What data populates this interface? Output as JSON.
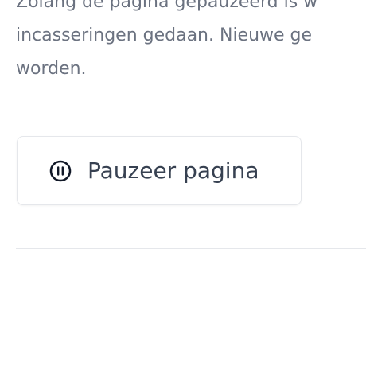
{
  "section": {
    "description_lines": [
      "Zolang de pagina gepauzeerd is w",
      "incasseringen gedaan. Nieuwe ge",
      "worden."
    ]
  },
  "pause_button": {
    "label": "Pauzeer pagina",
    "icon": "pause-circle-icon"
  },
  "colors": {
    "text_muted": "#6b7280",
    "text_primary": "#374151",
    "border": "#e5e7eb"
  }
}
